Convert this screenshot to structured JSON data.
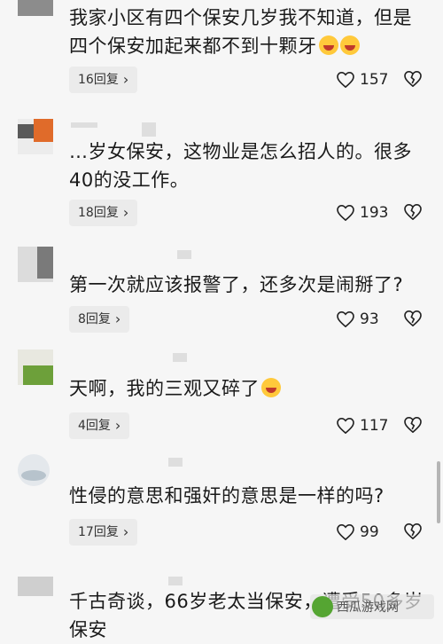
{
  "comments": [
    {
      "text": "我家小区有四个保安几岁我不知道，但是四个保安加起来都不到十颗牙",
      "reply": "16回复",
      "likes": "157"
    },
    {
      "text": "…岁女保安，这物业是怎么招人的。很多40的没工作。",
      "reply": "18回复",
      "likes": "193"
    },
    {
      "text": "第一次就应该报警了，还多次是闹掰了?",
      "reply": "8回复",
      "likes": "93"
    },
    {
      "text": "天啊，我的三观又碎了",
      "reply": "4回复",
      "likes": "117"
    },
    {
      "text": "性侵的意思和强奸的意思是一样的吗?",
      "reply": "17回复",
      "likes": "99"
    },
    {
      "text": "千古奇谈，66岁老太当保安，遭受50多岁保安",
      "likes": ""
    }
  ],
  "icons": {
    "reply_chevron": "chevron-right-icon",
    "like": "heart-icon",
    "dislike": "broken-heart-icon",
    "emoji": "laughing-emoji-icon"
  },
  "watermark": {
    "text": "西瓜游戏网"
  }
}
